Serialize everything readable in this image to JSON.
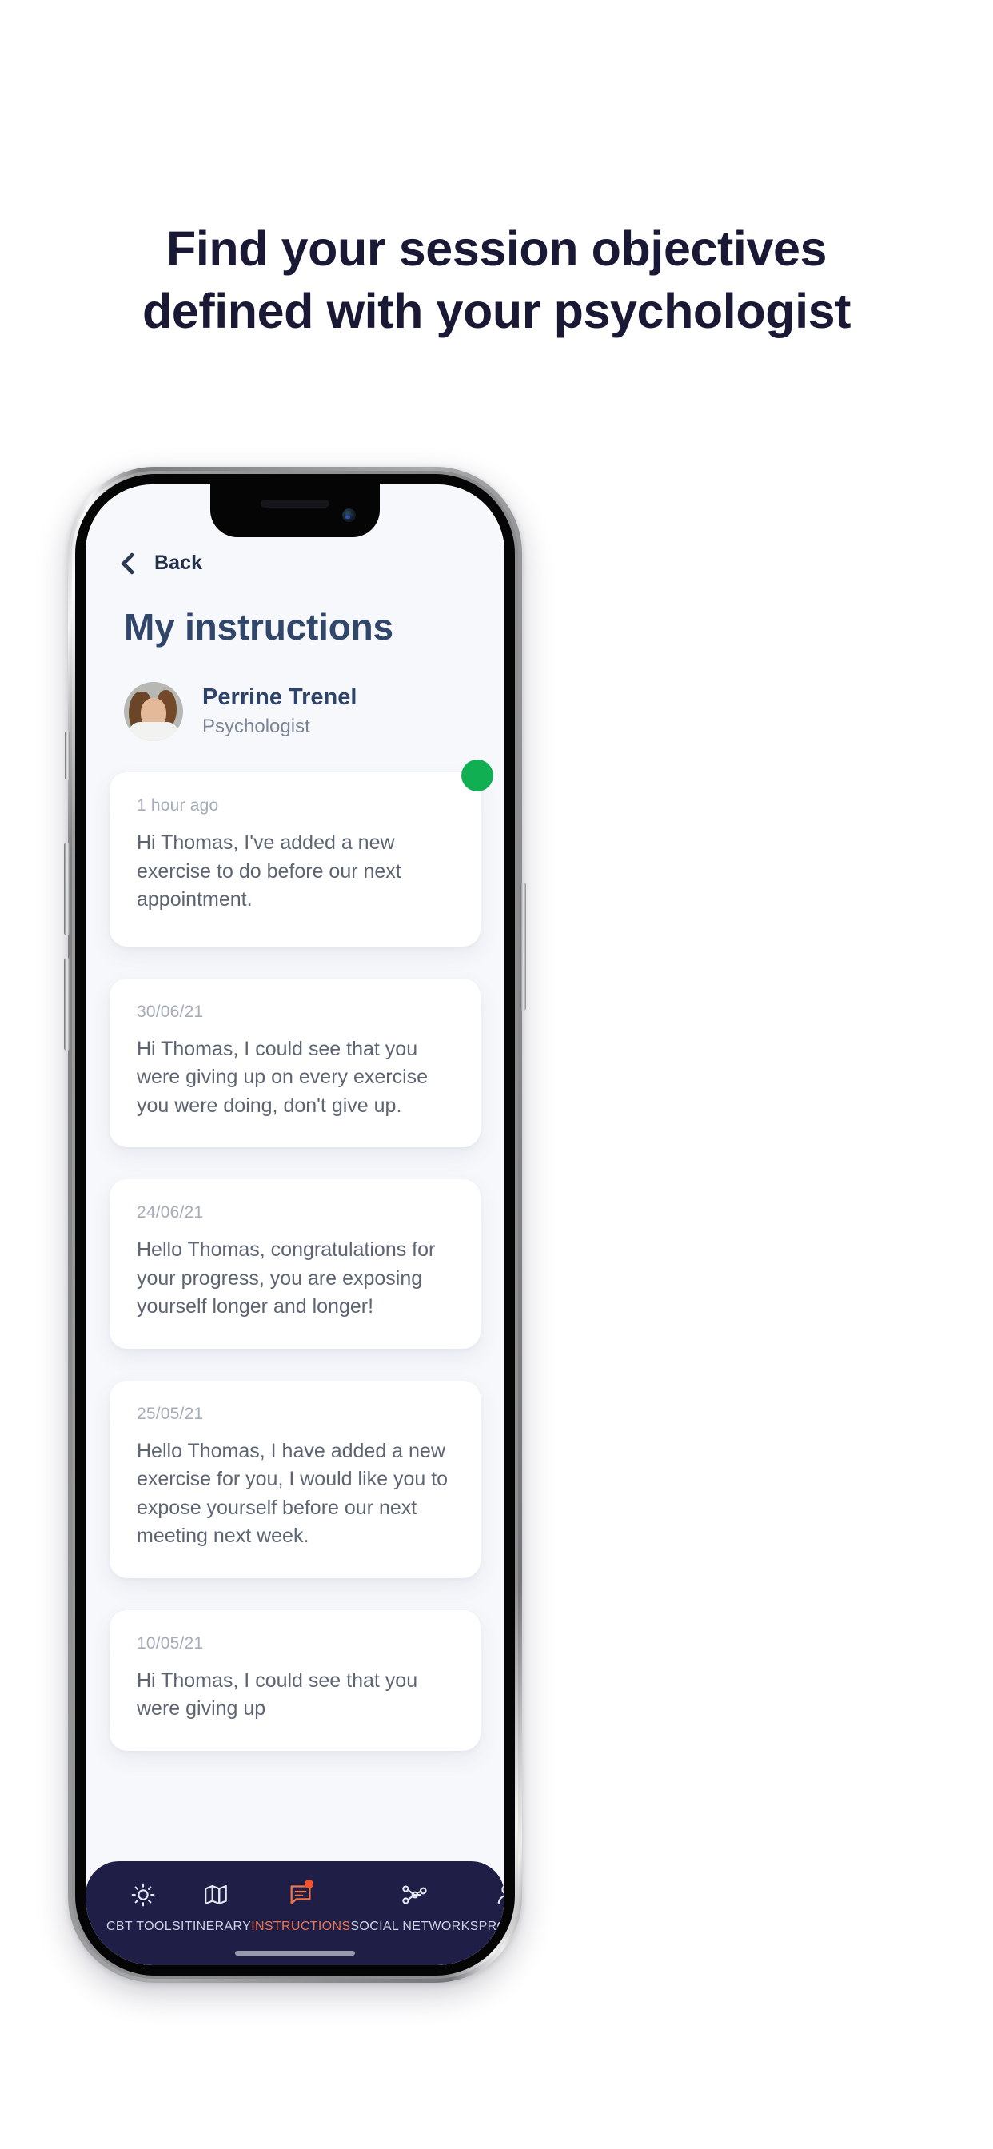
{
  "headline": {
    "line1": "Find your session objectives",
    "line2": "defined with your psychologist",
    "color": "#191935"
  },
  "app": {
    "back_label": "Back",
    "back_icon": "chevron-left-icon",
    "page_title": "My instructions",
    "doctor": {
      "name": "Perrine Trenel",
      "role": "Psychologist",
      "avatar_icon": "avatar-photo"
    },
    "messages": [
      {
        "date": "1 hour ago",
        "text": "Hi Thomas, I've added a new exercise to do before our next appointment.",
        "unread": true
      },
      {
        "date": "30/06/21",
        "text": "Hi Thomas, I could see that you were giving up on every exercise you were doing, don't give up.",
        "unread": false
      },
      {
        "date": "24/06/21",
        "text": "Hello Thomas, congratulations for your progress, you are exposing yourself longer and longer!",
        "unread": false
      },
      {
        "date": "25/05/21",
        "text": "Hello Thomas, I have added a new exercise for you, I would like you to expose yourself before our next meeting next week.",
        "unread": false
      },
      {
        "date": "10/05/21",
        "text": "Hi Thomas, I could see that you were giving up",
        "unread": false
      }
    ],
    "tabs": [
      {
        "label": "CBT TOOLS",
        "icon": "sun-icon",
        "active": false,
        "badge": false
      },
      {
        "label": "ITINERARY",
        "icon": "map-icon",
        "active": false,
        "badge": false
      },
      {
        "label": "INSTRUCTIONS",
        "icon": "chat-message-icon",
        "active": true,
        "badge": true
      },
      {
        "label": "SOCIAL NETWORKS",
        "icon": "network-nodes-icon",
        "active": false,
        "badge": false
      },
      {
        "label": "PROFILE",
        "icon": "person-icon",
        "active": false,
        "badge": false
      }
    ],
    "colors": {
      "tabbar_background": "#1e1e47",
      "tab_active": "#f0734a",
      "tab_inactive": "#cfd2e2",
      "unread_dot": "#10af52",
      "badge_dot": "#f1522b",
      "title": "#31466b",
      "screen_background": "#f7f8fb",
      "card_background": "#ffffff"
    }
  }
}
